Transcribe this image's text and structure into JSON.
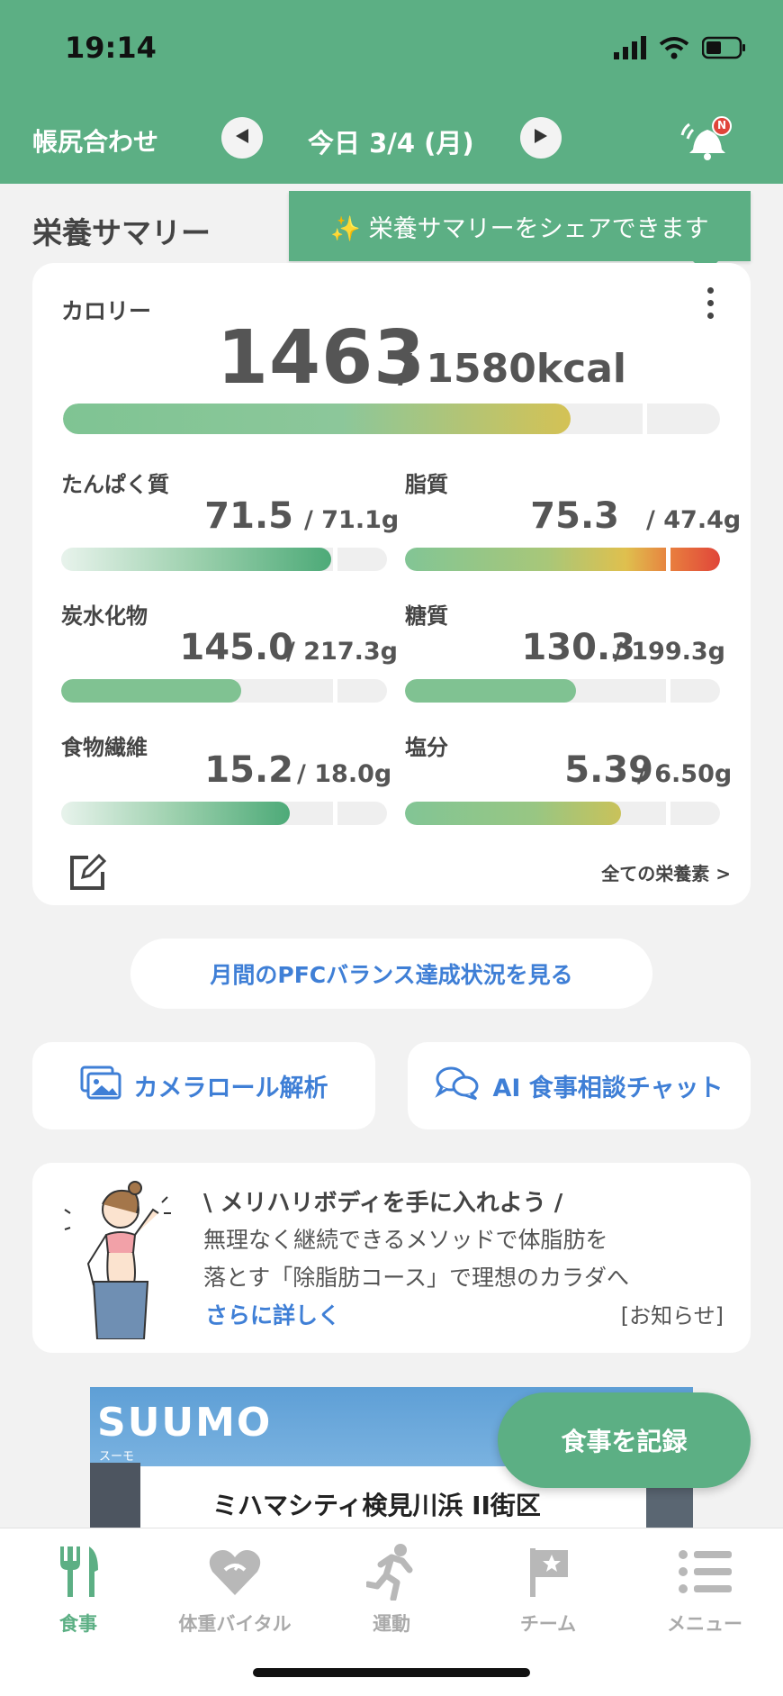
{
  "status": {
    "time": "19:14"
  },
  "header": {
    "left_label": "帳尻合わせ",
    "date": "今日 3/4 (月)",
    "notification_badge": "N"
  },
  "summary": {
    "title": "栄養サマリー",
    "share_tip": "✨ 栄養サマリーをシェアできます",
    "calorie": {
      "label": "カロリー",
      "value": "1463",
      "target": "/ 1580kcal",
      "progress": 0.926
    },
    "nutrients": [
      {
        "label": "たんぱく質",
        "value": "71.5",
        "target": "/ 71.1g",
        "progress": 1.0
      },
      {
        "label": "脂質",
        "value": "75.3",
        "target": "/ 47.4g",
        "progress": 1.59
      },
      {
        "label": "炭水化物",
        "value": "145.0",
        "target": "/ 217.3g",
        "progress": 0.667
      },
      {
        "label": "糖質",
        "value": "130.3",
        "target": "/ 199.3g",
        "progress": 0.654
      },
      {
        "label": "食物繊維",
        "value": "15.2",
        "target": "/ 18.0g",
        "progress": 0.844
      },
      {
        "label": "塩分",
        "value": "5.39",
        "target": "/ 6.50g",
        "progress": 0.829
      }
    ],
    "all_nutrients_link": "全ての栄養素 >"
  },
  "pfc_button": "月間のPFCバランス達成状況を見る",
  "tiles": {
    "camera_roll": "カメラロール解析",
    "ai_chat": "AI 食事相談チャット"
  },
  "promo": {
    "title": "\\ メリハリボディを手に入れよう /",
    "line1": "無理なく継続できるメソッドで体脂肪を",
    "line2": "落とす「除脂肪コース」で理想のカラダへ",
    "more": "さらに詳しく",
    "notice": "[お知らせ]"
  },
  "ad": {
    "logo": "SUUMO",
    "logo_sub": "スーモ",
    "text": "ミハマシティ検見川浜 II街区"
  },
  "fab": "食事を記録",
  "tabbar": {
    "items": [
      {
        "label": "食事"
      },
      {
        "label": "体重バイタル"
      },
      {
        "label": "運動"
      },
      {
        "label": "チーム"
      },
      {
        "label": "メニュー"
      }
    ]
  },
  "colors": {
    "brand_green": "#5caf84",
    "link_blue": "#3f7fd6",
    "warn_red": "#e0453a"
  }
}
